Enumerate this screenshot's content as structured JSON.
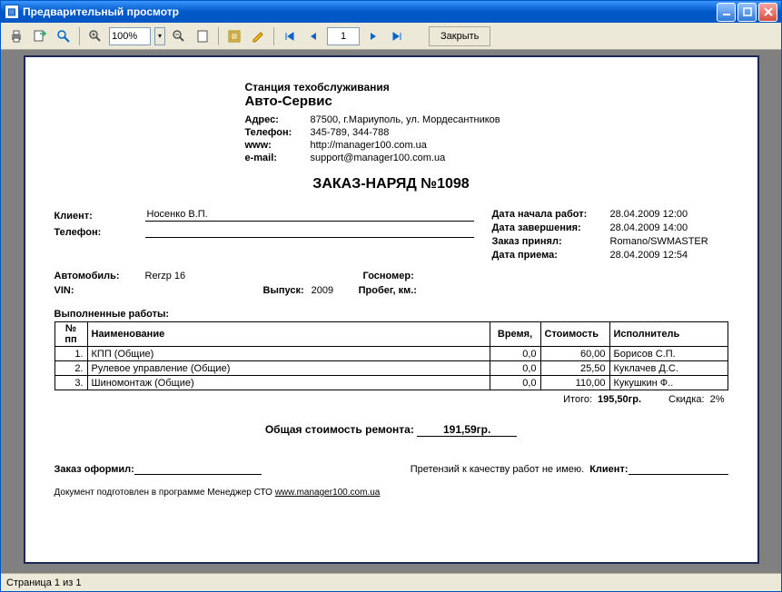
{
  "window": {
    "title": "Предварительный просмотр"
  },
  "toolbar": {
    "zoom": "100%",
    "page_current": "1",
    "close_label": "Закрыть"
  },
  "statusbar": {
    "text": "Страница 1 из 1"
  },
  "doc": {
    "station_line1": "Станция техобслуживания",
    "station_name": "Авто-Сервис",
    "address_lbl": "Адрес:",
    "address": "87500, г.Мариуполь, ул. Мордесантников",
    "phone_lbl": "Телефон:",
    "phone": "345-789, 344-788",
    "www_lbl": "www:",
    "www": "http://manager100.com.ua",
    "email_lbl": "e-mail:",
    "email": "support@manager100.com.ua",
    "title": "ЗАКАЗ-НАРЯД №1098",
    "client_lbl": "Клиент:",
    "client": "Носенко В.П.",
    "client_phone_lbl": "Телефон:",
    "client_phone": "",
    "car_lbl": "Автомобиль:",
    "car": "Rerzp 16",
    "gosnomer_lbl": "Госномер:",
    "vin_lbl": "VIN:",
    "vin": "",
    "year_lbl": "Выпуск:",
    "year": "2009",
    "mileage_lbl": "Пробег, км.:",
    "mileage": "",
    "start_lbl": "Дата начала работ:",
    "start": "28.04.2009 12:00",
    "end_lbl": "Дата завершения:",
    "end": "28.04.2009 14:00",
    "accepted_lbl": "Заказ принял:",
    "accepted": "Romano/SWMASTER",
    "received_lbl": "Дата приема:",
    "received": "28.04.2009 12:54",
    "works_title": "Выполненные работы:",
    "th_num": "№ пп",
    "th_name": "Наименование",
    "th_time": "Время,",
    "th_cost": "Стоимость",
    "th_exec": "Исполнитель",
    "rows": [
      {
        "n": "1.",
        "name": "КПП (Общие)",
        "time": "0,0",
        "cost": "60,00",
        "exec": "Борисов С.П."
      },
      {
        "n": "2.",
        "name": "Рулевое управление (Общие)",
        "time": "0,0",
        "cost": "25,50",
        "exec": "Куклачев Д.С."
      },
      {
        "n": "3.",
        "name": "Шиномонтаж (Общие)",
        "time": "0,0",
        "cost": "110,00",
        "exec": "Кукушкин Ф.."
      }
    ],
    "itogo_lbl": "Итого:",
    "itogo": "195,50гр.",
    "discount_lbl": "Скидка:",
    "discount": "2%",
    "grand_lbl": "Общая стоимость ремонта:",
    "grand": "191,59гр.",
    "signed_lbl": "Заказ оформил:",
    "claim_text": "Претензий к качеству работ не имею.",
    "client_sign_lbl": "Клиент:",
    "footer_text": "Документ подготовлен в программе Менеджер СТО ",
    "footer_link": "www.manager100.com.ua"
  }
}
